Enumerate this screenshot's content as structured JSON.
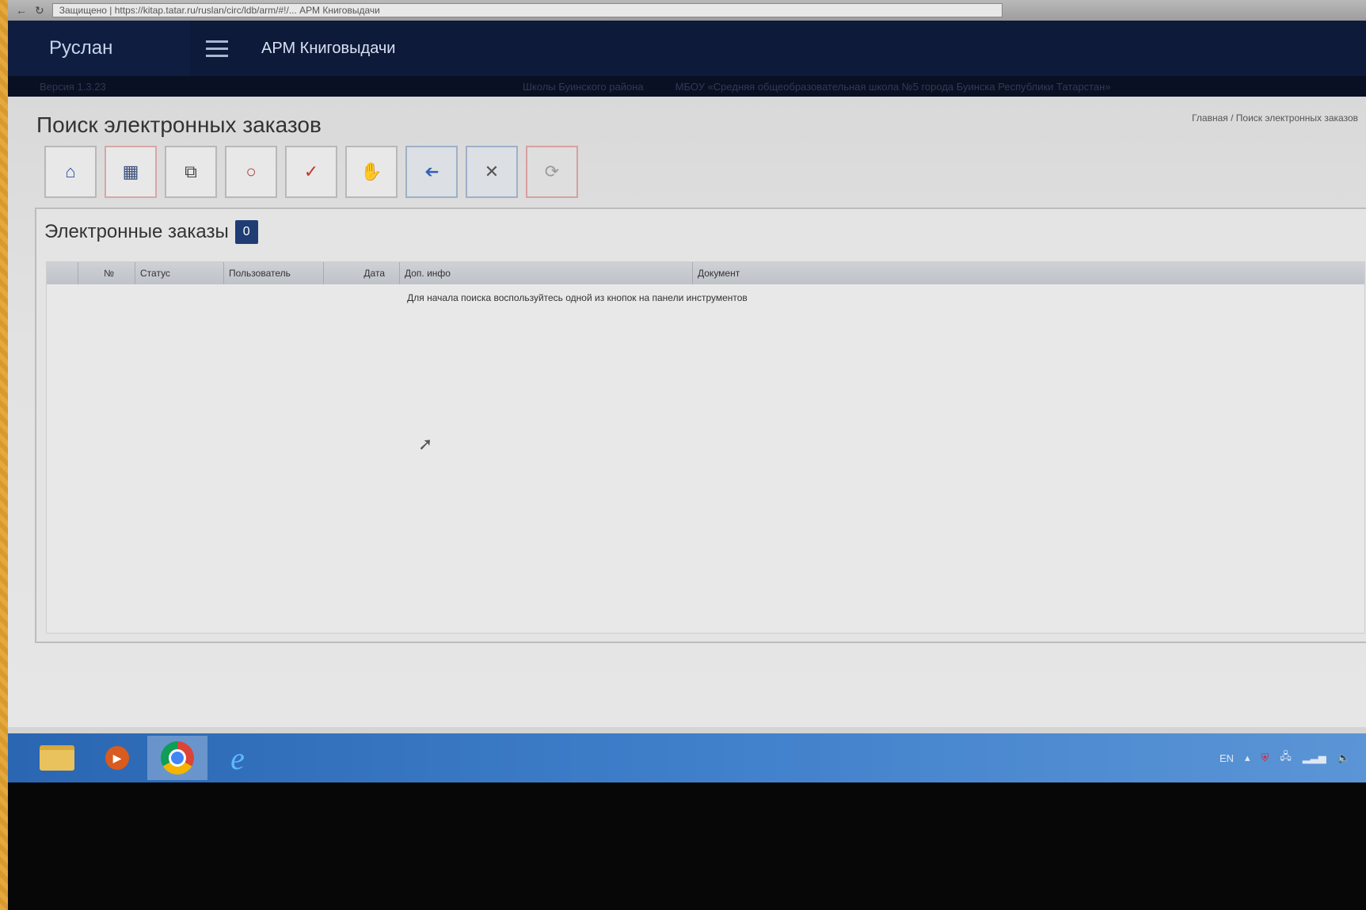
{
  "browser": {
    "back_icon": "←",
    "reload_icon": "↻",
    "url": "Защищено | https://kitap.tatar.ru/ruslan/circ/ldb/arm/#!/... АРМ Книговыдачи"
  },
  "header": {
    "brand": "Руслан",
    "app_title": "АРМ Книговыдачи",
    "version": "Версия 1.3.23",
    "org_district": "Школы Буинского района",
    "org_name": "МБОУ «Средняя общеобразовательная школа №5 города Буинска Республики Татарстан»"
  },
  "page": {
    "title": "Поиск электронных заказов",
    "breadcrumb": "Главная / Поиск электронных заказов"
  },
  "toolbar": [
    {
      "name": "home-icon",
      "glyph": "⌂"
    },
    {
      "name": "barcode-icon",
      "glyph": "▦"
    },
    {
      "name": "copy-icon",
      "glyph": "⧉"
    },
    {
      "name": "ring-icon",
      "glyph": "○"
    },
    {
      "name": "check-icon",
      "glyph": "✓"
    },
    {
      "name": "hand-icon",
      "glyph": "✋"
    },
    {
      "name": "back-arrow-icon",
      "glyph": "➔"
    },
    {
      "name": "close-icon",
      "glyph": "✕"
    },
    {
      "name": "refresh-icon",
      "glyph": "⟳"
    }
  ],
  "orders": {
    "title": "Электронные заказы",
    "count": "0",
    "columns": [
      "",
      "№",
      "Статус",
      "Пользователь",
      "Дата",
      "Доп. инфо",
      "Документ"
    ],
    "empty_message": "Для начала поиска воспользуйтесь одной из кнопок на панели инструментов"
  },
  "taskbar": {
    "lang": "EN",
    "tray_icons": [
      "arrow-up-icon",
      "shield-icon",
      "network-icon",
      "signal-icon",
      "volume-icon"
    ]
  },
  "colors": {
    "header_bg": "#0e1a3a",
    "badge": "#1f3d74",
    "taskbar": "#3f7fca",
    "frame": "#e0a33a"
  }
}
